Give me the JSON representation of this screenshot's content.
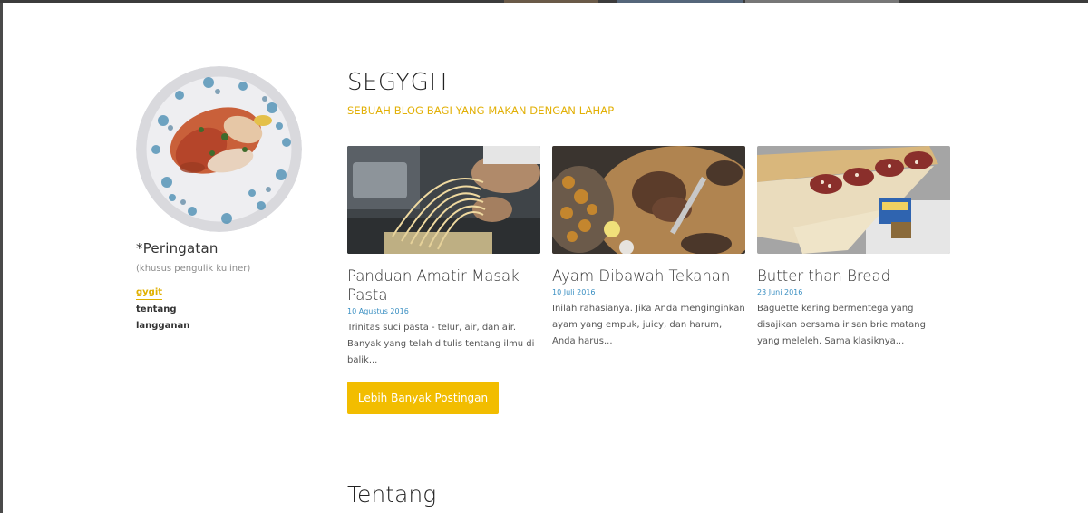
{
  "sidebar": {
    "brand_name": "*Peringatan",
    "brand_sub": "(khusus pengulik kuliner)",
    "nav": [
      "gygit",
      "tentang",
      "langganan"
    ]
  },
  "header": {
    "title": "SEGYGIT",
    "tagline": "SEBUAH BLOG BAGI YANG MAKAN DENGAN LAHAP"
  },
  "posts": [
    {
      "title": "Panduan Amatir Masak Pasta",
      "date": "10 Agustus 2016",
      "excerpt": "Trinitas suci pasta - telur, air, dan air. Banyak yang telah ditulis tentang ilmu di balik..."
    },
    {
      "title": "Ayam Dibawah Tekanan",
      "date": "10 Juli 2016",
      "excerpt": "Inilah rahasianya. Jika Anda menginginkan ayam yang empuk, juicy, dan harum, Anda harus..."
    },
    {
      "title": "Butter than Bread",
      "date": "23 Juni 2016",
      "excerpt": "Baguette kering bermentega yang disajikan bersama irisan brie matang yang meleleh. Sama klasiknya..."
    }
  ],
  "more_button": "Lebih Banyak Postingan",
  "about_heading": "Tentang",
  "colors": {
    "accent": "#f2bd00",
    "tagline": "#e2b007",
    "date": "#3a8fc2"
  }
}
